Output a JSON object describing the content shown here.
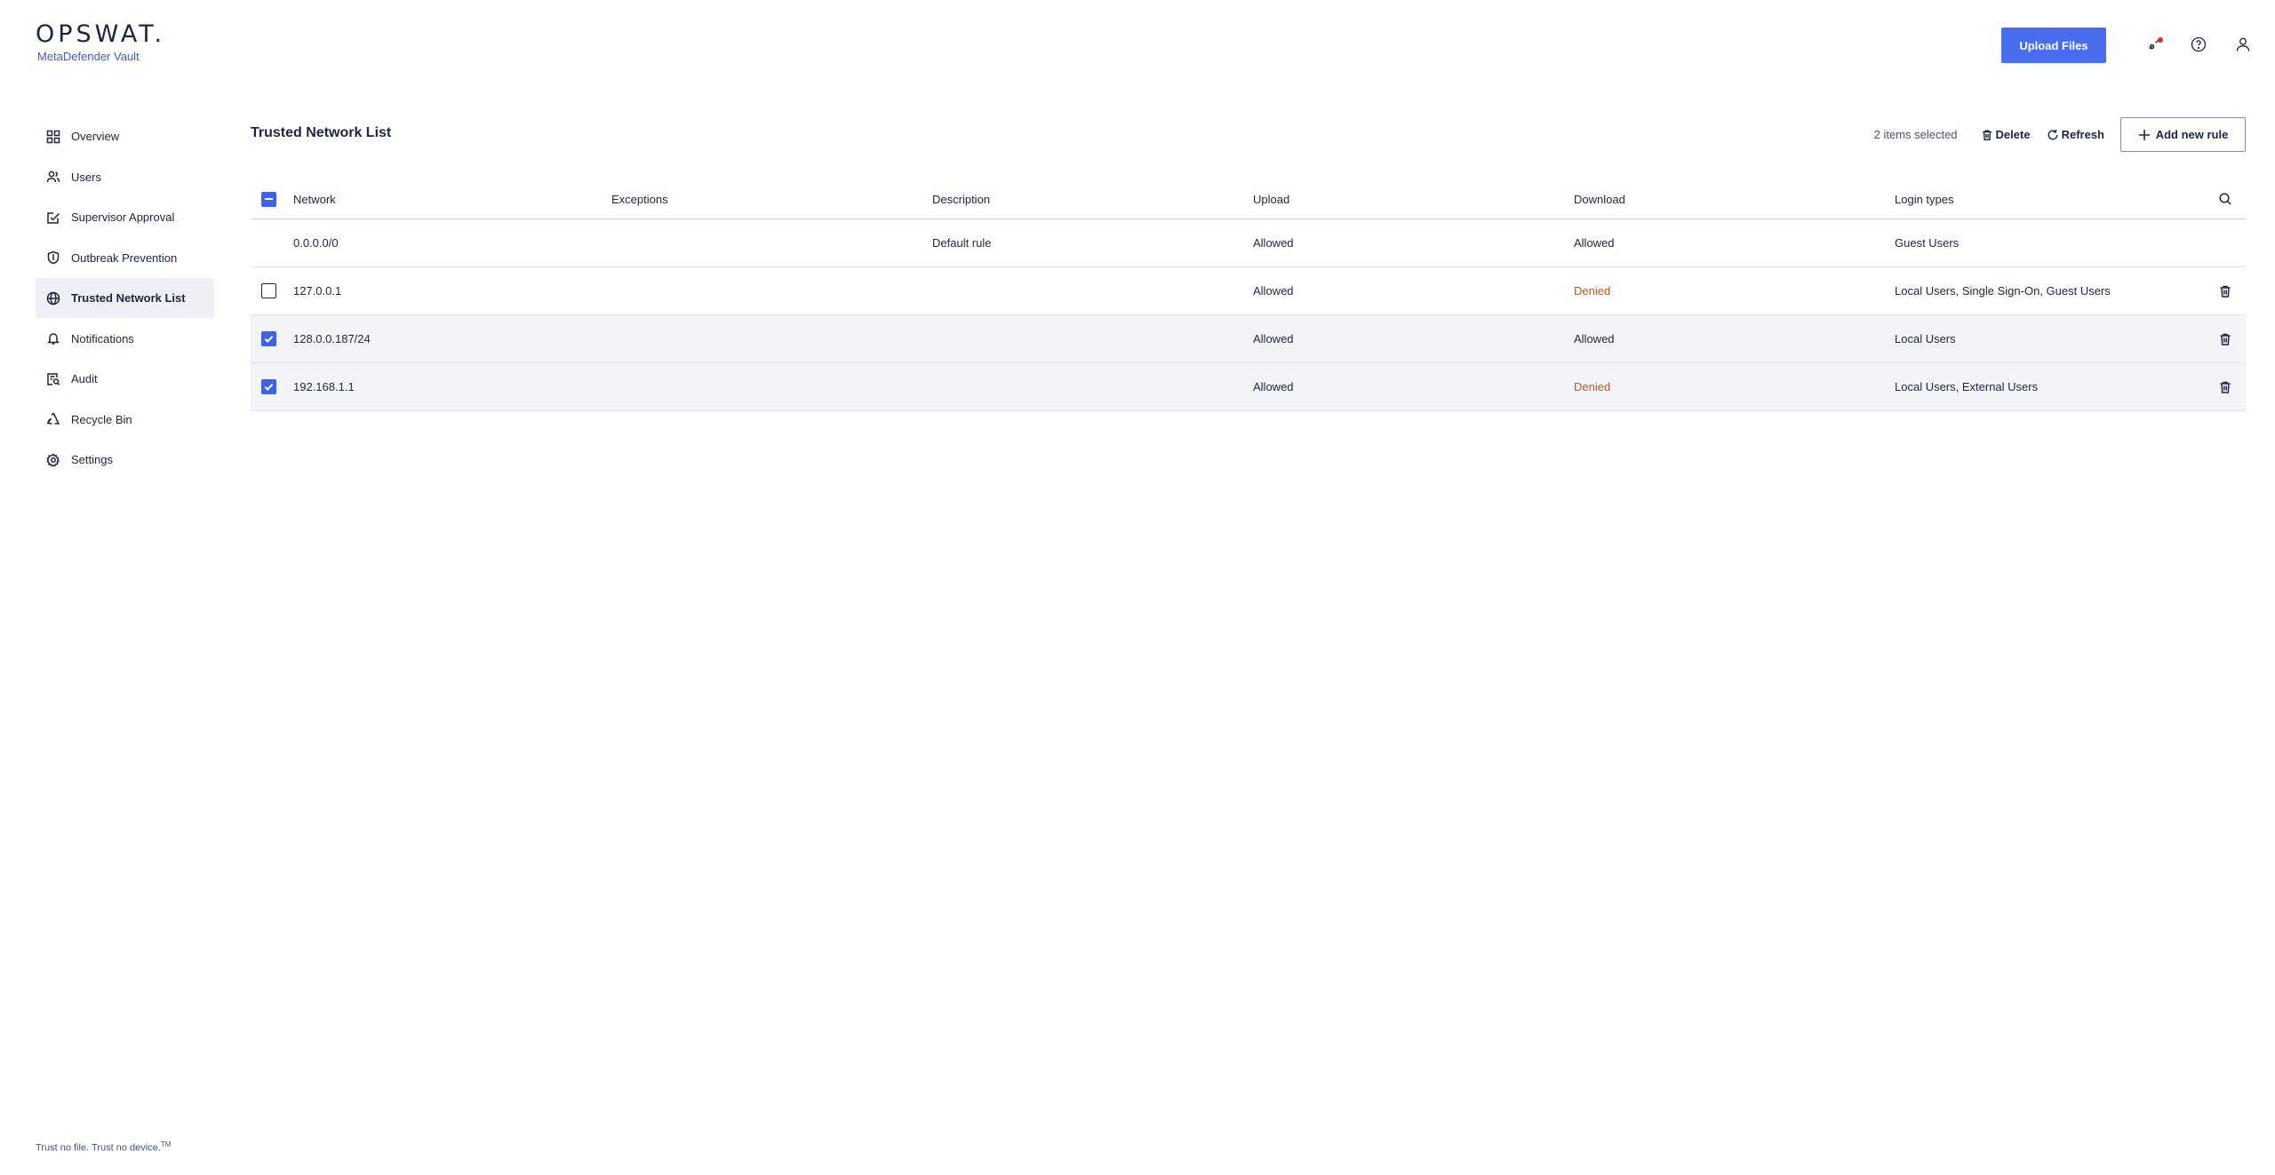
{
  "brand": {
    "logo": "OPSWAT.",
    "product": "MetaDefender Vault"
  },
  "header": {
    "upload_label": "Upload Files"
  },
  "sidebar": {
    "items": [
      {
        "label": "Overview",
        "icon": "grid-icon"
      },
      {
        "label": "Users",
        "icon": "users-icon"
      },
      {
        "label": "Supervisor Approval",
        "icon": "approval-icon"
      },
      {
        "label": "Outbreak Prevention",
        "icon": "shield-icon"
      },
      {
        "label": "Trusted Network List",
        "icon": "globe-icon",
        "active": true
      },
      {
        "label": "Notifications",
        "icon": "bell-icon"
      },
      {
        "label": "Audit",
        "icon": "audit-icon"
      },
      {
        "label": "Recycle Bin",
        "icon": "recycle-icon"
      },
      {
        "label": "Settings",
        "icon": "gear-icon"
      }
    ]
  },
  "main": {
    "title": "Trusted Network List",
    "toolbar": {
      "selected_count": "2 items selected",
      "delete_label": "Delete",
      "refresh_label": "Refresh",
      "add_label": "Add new rule"
    },
    "columns": [
      "Network",
      "Exceptions",
      "Description",
      "Upload",
      "Download",
      "Login types"
    ],
    "rows": [
      {
        "network": "0.0.0.0/0",
        "exceptions": "",
        "description": "Default rule",
        "upload": "Allowed",
        "download": "Allowed",
        "login": "Guest Users",
        "selectable": false,
        "checked": false
      },
      {
        "network": "127.0.0.1",
        "exceptions": "",
        "description": "",
        "upload": "Allowed",
        "download": "Denied",
        "login": "Local Users, Single Sign-On, Guest Users",
        "selectable": true,
        "checked": false
      },
      {
        "network": "128.0.0.187/24",
        "exceptions": "",
        "description": "",
        "upload": "Allowed",
        "download": "Allowed",
        "login": "Local Users",
        "selectable": true,
        "checked": true
      },
      {
        "network": "192.168.1.1",
        "exceptions": "",
        "description": "",
        "upload": "Allowed",
        "download": "Denied",
        "login": "Local Users, External Users",
        "selectable": true,
        "checked": true
      }
    ]
  },
  "footer": {
    "tagline": "Trust no file. Trust no device.",
    "tm": "TM"
  },
  "colors": {
    "accent": "#4a6df0",
    "denied": "#c0541a",
    "selected_row": "#f3f4f8"
  }
}
